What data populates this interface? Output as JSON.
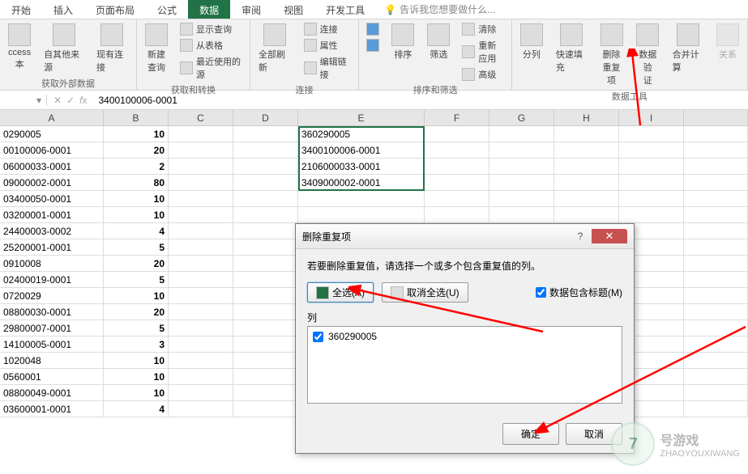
{
  "tabs": [
    "开始",
    "插入",
    "页面布局",
    "公式",
    "数据",
    "审阅",
    "视图",
    "开发工具"
  ],
  "active_tab_index": 4,
  "tell_me": "告诉我您想要做什么...",
  "ribbon": {
    "group1": {
      "title": "获取外部数据",
      "btn_access": "ccess\n本",
      "btn_other": "自其他来源",
      "btn_conn": "现有连接"
    },
    "group2": {
      "title": "获取和转换",
      "btn_new": "新建\n查询",
      "s1": "显示查询",
      "s2": "从表格",
      "s3": "最近使用的源"
    },
    "group3": {
      "title": "连接",
      "btn_refresh": "全部刷新",
      "s1": "连接",
      "s2": "属性",
      "s3": "编辑链接"
    },
    "group4": {
      "title": "排序和筛选",
      "btn_az": "A↓Z",
      "btn_za": "Z↓A",
      "btn_sort": "排序",
      "btn_filter": "筛选",
      "s1": "清除",
      "s2": "重新应用",
      "s3": "高级"
    },
    "group5": {
      "title": "数据工具",
      "btn_split": "分列",
      "btn_flash": "快速填充",
      "btn_dedup": "删除\n重复项",
      "btn_valid": "数据验\n证",
      "btn_consol": "合并计算",
      "btn_rel": "关系"
    }
  },
  "formula_bar": {
    "value": "3400100006-0001"
  },
  "columns": [
    "A",
    "B",
    "C",
    "D",
    "E",
    "F",
    "G",
    "H",
    "I",
    ""
  ],
  "rows": [
    {
      "a": "0290005",
      "b": "10",
      "e": "360290005"
    },
    {
      "a": "00100006-0001",
      "b": "20",
      "e": "3400100006-0001"
    },
    {
      "a": "06000033-0001",
      "b": "2",
      "e": "2106000033-0001"
    },
    {
      "a": "09000002-0001",
      "b": "80",
      "e": "3409000002-0001"
    },
    {
      "a": "03400050-0001",
      "b": "10",
      "e": ""
    },
    {
      "a": "03200001-0001",
      "b": "10",
      "e": ""
    },
    {
      "a": "24400003-0002",
      "b": "4",
      "e": ""
    },
    {
      "a": "25200001-0001",
      "b": "5",
      "e": ""
    },
    {
      "a": "0910008",
      "b": "20",
      "e": ""
    },
    {
      "a": "02400019-0001",
      "b": "5",
      "e": ""
    },
    {
      "a": "0720029",
      "b": "10",
      "e": ""
    },
    {
      "a": "08800030-0001",
      "b": "20",
      "e": ""
    },
    {
      "a": "29800007-0001",
      "b": "5",
      "e": ""
    },
    {
      "a": "14100005-0001",
      "b": "3",
      "e": ""
    },
    {
      "a": "1020048",
      "b": "10",
      "e": ""
    },
    {
      "a": "0560001",
      "b": "10",
      "e": ""
    },
    {
      "a": "08800049-0001",
      "b": "10",
      "e": ""
    },
    {
      "a": "03600001-0001",
      "b": "4",
      "e": ""
    }
  ],
  "dialog": {
    "title": "删除重复项",
    "msg": "若要删除重复值，请选择一个或多个包含重复值的列。",
    "select_all": "全选(A)",
    "deselect_all": "取消全选(U)",
    "has_header": "数据包含标题(M)",
    "col_label": "列",
    "item": "360290005",
    "ok": "确定",
    "cancel": "取消"
  },
  "watermark": {
    "brand": "号游戏",
    "sub": "ZHAOYOUXIWANG"
  }
}
